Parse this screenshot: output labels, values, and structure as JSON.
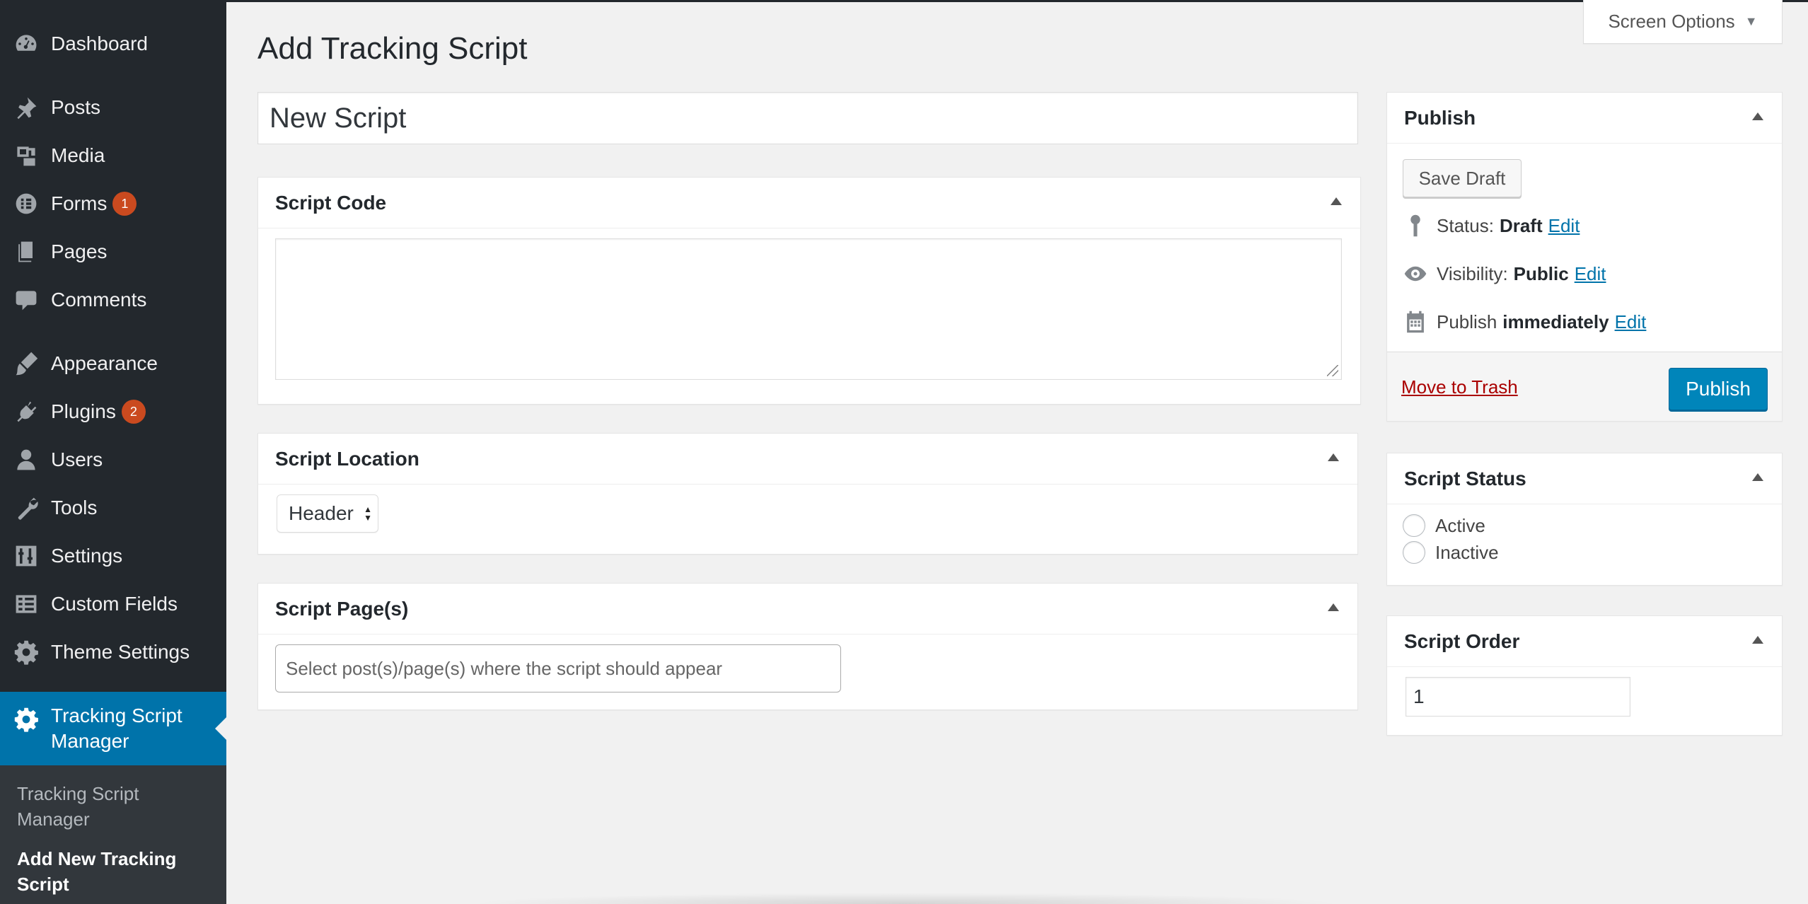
{
  "sidebar": {
    "items": [
      {
        "label": "Dashboard",
        "icon": "dashboard-icon"
      },
      {
        "label": "Posts",
        "icon": "pin-icon"
      },
      {
        "label": "Media",
        "icon": "media-icon"
      },
      {
        "label": "Forms",
        "icon": "forms-icon",
        "badge": "1"
      },
      {
        "label": "Pages",
        "icon": "pages-icon"
      },
      {
        "label": "Comments",
        "icon": "comment-icon"
      },
      {
        "label": "Appearance",
        "icon": "brush-icon"
      },
      {
        "label": "Plugins",
        "icon": "plug-icon",
        "badge": "2"
      },
      {
        "label": "Users",
        "icon": "user-icon"
      },
      {
        "label": "Tools",
        "icon": "wrench-icon"
      },
      {
        "label": "Settings",
        "icon": "sliders-icon"
      },
      {
        "label": "Custom Fields",
        "icon": "table-icon"
      },
      {
        "label": "Theme Settings",
        "icon": "gear-icon"
      }
    ],
    "active": {
      "label": "Tracking Script Manager",
      "icon": "gear-icon"
    },
    "submenu": [
      {
        "label": "Tracking Script Manager"
      },
      {
        "label": "Add New Tracking Script"
      }
    ]
  },
  "header": {
    "screen_options": "Screen Options",
    "page_title": "Add Tracking Script"
  },
  "main": {
    "title_value": "New Script",
    "script_code": {
      "heading": "Script Code",
      "value": ""
    },
    "script_location": {
      "heading": "Script Location",
      "selected": "Header"
    },
    "script_pages": {
      "heading": "Script Page(s)",
      "placeholder": "Select post(s)/page(s) where the script should appear"
    }
  },
  "publish": {
    "heading": "Publish",
    "save_draft": "Save Draft",
    "status_label": "Status:",
    "status_value": "Draft",
    "visibility_label": "Visibility:",
    "visibility_value": "Public",
    "publish_label": "Publish",
    "publish_value": "immediately",
    "edit": "Edit",
    "move_to_trash": "Move to Trash",
    "publish_button": "Publish"
  },
  "script_status": {
    "heading": "Script Status",
    "options": [
      "Active",
      "Inactive"
    ]
  },
  "script_order": {
    "heading": "Script Order",
    "value": "1"
  },
  "colors": {
    "sidebar_bg": "#23282d",
    "active_menu": "#0073aa",
    "badge": "#ca4a1f",
    "primary_button": "#0085ba",
    "link": "#0073aa",
    "trash": "#a00"
  }
}
